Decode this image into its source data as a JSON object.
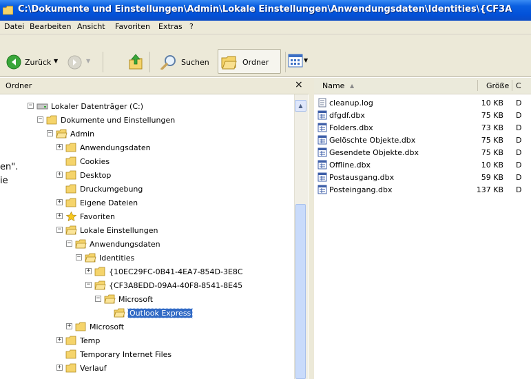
{
  "window": {
    "title": "C:\\Dokumente und Einstellungen\\Admin\\Lokale Einstellungen\\Anwendungsdaten\\Identities\\{CF3A"
  },
  "menu": [
    "Datei",
    "Bearbeiten",
    "Ansicht",
    "Favoriten",
    "Extras",
    "?"
  ],
  "toolbar": {
    "back_label": "Zurück",
    "search_label": "Suchen",
    "folders_label": "Ordner"
  },
  "left_pane": {
    "header": "Ordner",
    "close_glyph": "×"
  },
  "tree": [
    {
      "label": "Lokaler Datenträger (C:)",
      "expander": "−",
      "icon": "drive-icon"
    },
    {
      "label": "Dokumente und Einstellungen",
      "expander": "−",
      "icon": "folder-icon"
    },
    {
      "label": "Admin",
      "expander": "−",
      "icon": "folder-open-icon"
    },
    {
      "label": "Anwendungsdaten",
      "expander": "+",
      "icon": "folder-icon"
    },
    {
      "label": "Cookies",
      "expander": "",
      "icon": "folder-icon"
    },
    {
      "label": "Desktop",
      "expander": "+",
      "icon": "folder-icon"
    },
    {
      "label": "Druckumgebung",
      "expander": "",
      "icon": "folder-icon"
    },
    {
      "label": "Eigene Dateien",
      "expander": "+",
      "icon": "folder-icon"
    },
    {
      "label": "Favoriten",
      "expander": "+",
      "icon": "star-folder-icon"
    },
    {
      "label": "Lokale Einstellungen",
      "expander": "−",
      "icon": "folder-open-icon"
    },
    {
      "label": "Anwendungsdaten",
      "expander": "−",
      "icon": "folder-open-icon"
    },
    {
      "label": "Identities",
      "expander": "−",
      "icon": "folder-open-icon"
    },
    {
      "label": "{10EC29FC-0B41-4EA7-854D-3E8C",
      "expander": "+",
      "icon": "folder-icon"
    },
    {
      "label": "{CF3A8EDD-09A4-40F8-8541-8E45",
      "expander": "−",
      "icon": "folder-open-icon"
    },
    {
      "label": "Microsoft",
      "expander": "−",
      "icon": "folder-open-icon"
    },
    {
      "label": "Outlook Express",
      "expander": "",
      "icon": "folder-open-icon",
      "selected": true
    },
    {
      "label": "Microsoft",
      "expander": "+",
      "icon": "folder-icon"
    },
    {
      "label": "Temp",
      "expander": "+",
      "icon": "folder-icon"
    },
    {
      "label": "Temporary Internet Files",
      "expander": "",
      "icon": "folder-icon"
    },
    {
      "label": "Verlauf",
      "expander": "+",
      "icon": "folder-icon"
    }
  ],
  "file_list": {
    "columns": {
      "name": "Name",
      "size": "Größe",
      "type": "C"
    },
    "files": [
      {
        "name": "cleanup.log",
        "size": "10 KB",
        "type": "D",
        "icon": "text-file-icon"
      },
      {
        "name": "dfgdf.dbx",
        "size": "75 KB",
        "type": "D",
        "icon": "dbx-file-icon"
      },
      {
        "name": "Folders.dbx",
        "size": "73 KB",
        "type": "D",
        "icon": "dbx-file-icon"
      },
      {
        "name": "Gelöschte Objekte.dbx",
        "size": "75 KB",
        "type": "D",
        "icon": "dbx-file-icon"
      },
      {
        "name": "Gesendete Objekte.dbx",
        "size": "75 KB",
        "type": "D",
        "icon": "dbx-file-icon"
      },
      {
        "name": "Offline.dbx",
        "size": "10 KB",
        "type": "D",
        "icon": "dbx-file-icon"
      },
      {
        "name": "Postausgang.dbx",
        "size": "59 KB",
        "type": "D",
        "icon": "dbx-file-icon"
      },
      {
        "name": "Posteingang.dbx",
        "size": "137 KB",
        "type": "D",
        "icon": "dbx-file-icon"
      }
    ]
  },
  "background_text": [
    "en\".",
    "ie"
  ],
  "colors": {
    "titlebar": "#0351d8",
    "chrome": "#ece9d8",
    "selection": "#316ac5",
    "folder": "#f5d46b"
  }
}
